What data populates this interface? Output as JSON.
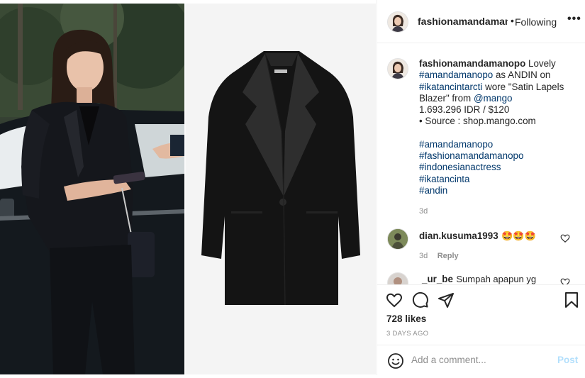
{
  "header": {
    "username": "fashionamandamanopo",
    "separator": "•",
    "follow_status": "Following",
    "more_icon": "more-horizontal-icon"
  },
  "caption": {
    "username": "fashionamandamanopo",
    "text_1": "Lovely",
    "tag_1": "#amandamanopo",
    "text_2": "as ANDIN on",
    "tag_2": "#ikatancintarcti",
    "text_3": "wore \"Satin Lapels Blazer\" from",
    "mention": "@mango",
    "price": "1.693.296 IDR / $120",
    "source": "• Source : shop.mango.com",
    "hashtags": [
      "#amandamanopo",
      "#fashionamandamanopo",
      "#indonesianactress",
      "#ikatancinta",
      "#andin"
    ],
    "time": "3d"
  },
  "comments": [
    {
      "username": "dian.kusuma1993",
      "text": "🤩🤩🤩",
      "time": "3d",
      "reply": "Reply"
    },
    {
      "username": "_ur_be",
      "text": "Sumpah apapun yg"
    }
  ],
  "actions": {
    "likes": "728 likes",
    "time_ago": "3 DAYS AGO"
  },
  "add_comment": {
    "placeholder": "Add a comment...",
    "post_label": "Post"
  },
  "colors": {
    "link": "#00376b",
    "muted": "#8e8e8e",
    "post_disabled": "#b2dffc",
    "border": "#efefef"
  }
}
